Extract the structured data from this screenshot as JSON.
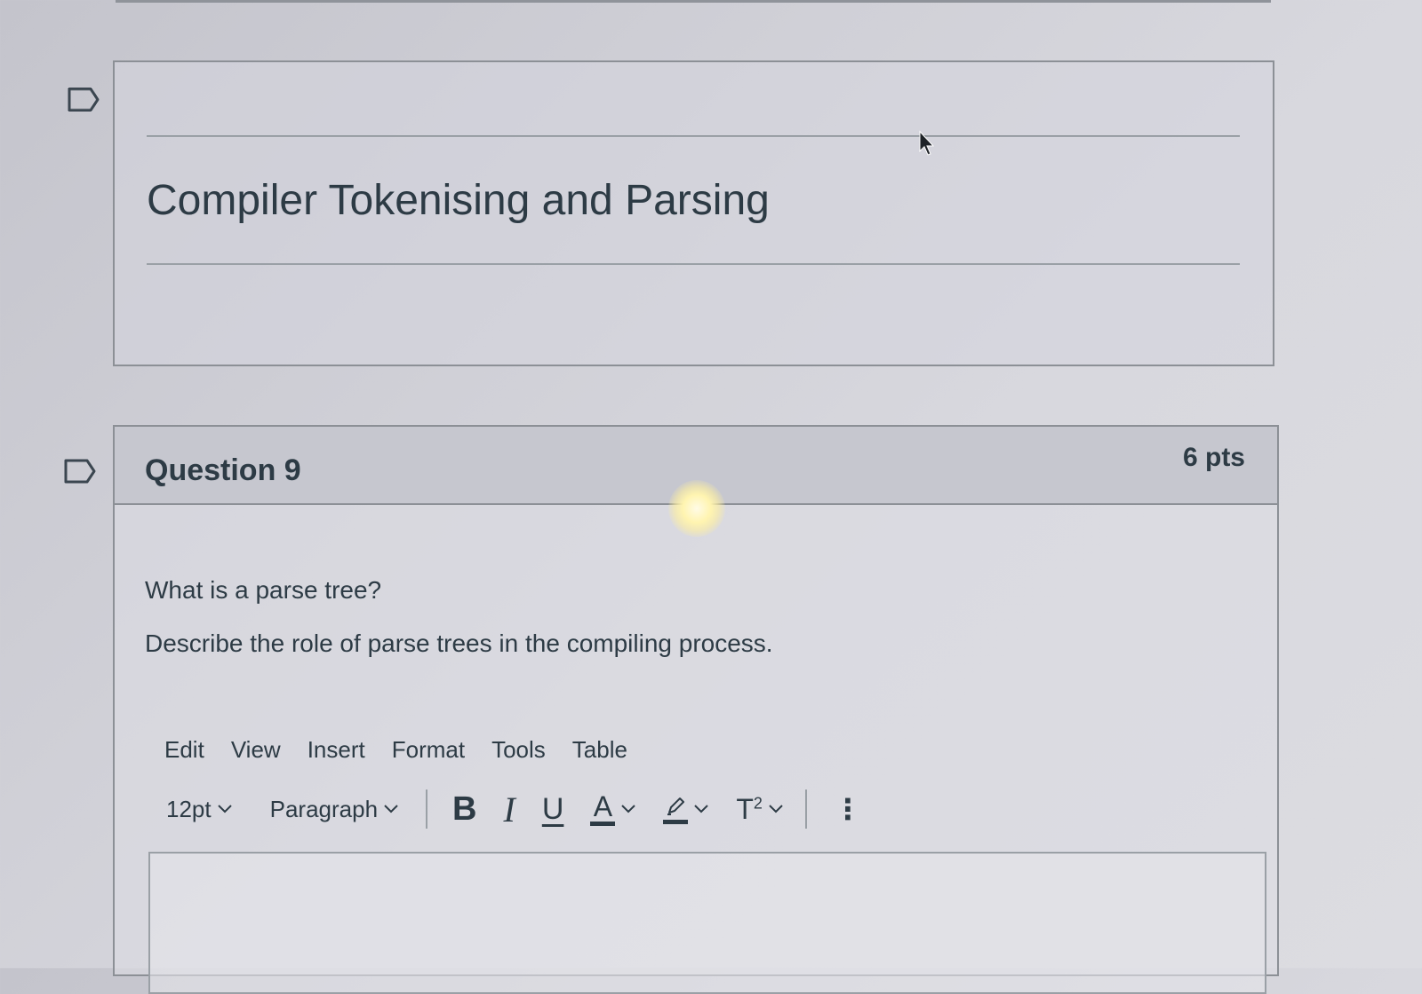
{
  "header_section": {
    "title": "Compiler Tokenising and Parsing"
  },
  "question": {
    "title": "Question 9",
    "points": "6 pts",
    "prompt_line_1": "What is a parse tree?",
    "prompt_line_2": "Describe the role of parse trees in the compiling process."
  },
  "editor": {
    "menu": [
      "Edit",
      "View",
      "Insert",
      "Format",
      "Tools",
      "Table"
    ],
    "toolbar": {
      "font_size": "12pt",
      "block_format": "Paragraph",
      "bold_label": "B",
      "italic_label": "I",
      "underline_label": "U",
      "font_color_label": "A",
      "superscript_label": "T",
      "superscript_mark": "2",
      "more_label": "⋮"
    },
    "content": ""
  }
}
